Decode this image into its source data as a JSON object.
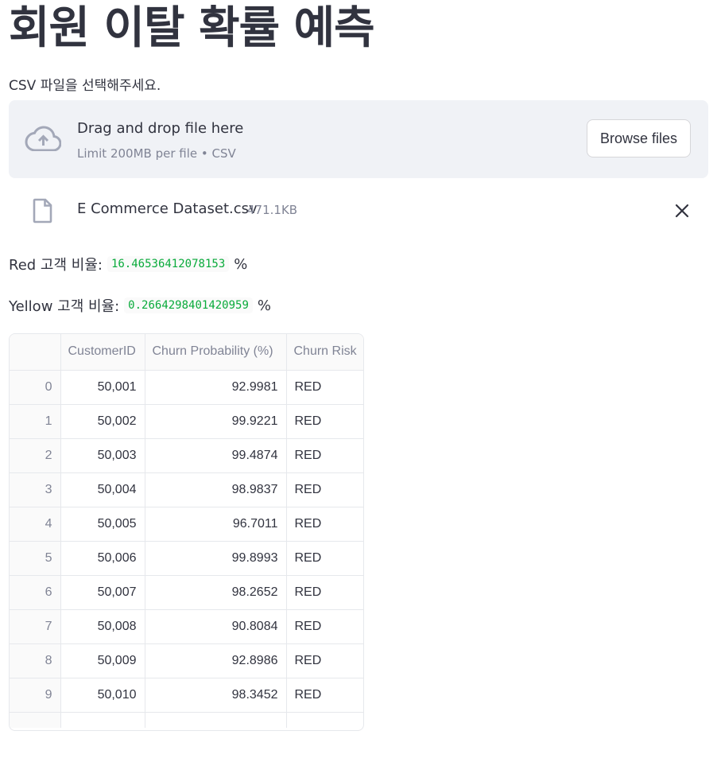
{
  "page": {
    "title": "회원 이탈 확률 예측"
  },
  "uploader": {
    "label": "CSV 파일을 선택해주세요.",
    "drop_text": "Drag and drop file here",
    "limit_text": "Limit 200MB per file • CSV",
    "browse_label": "Browse files",
    "upload_icon": "cloud-upload-icon"
  },
  "uploaded_file": {
    "name": "E Commerce Dataset.csv",
    "size": "471.1KB",
    "file_icon": "file-icon",
    "remove_icon": "close-icon"
  },
  "ratios": {
    "red_label": "Red 고객 비율:",
    "red_value": "16.46536412078153",
    "yellow_label": "Yellow 고객 비율:",
    "yellow_value": "0.2664298401420959",
    "unit": "%"
  },
  "table": {
    "columns": [
      "",
      "CustomerID",
      "Churn Probability (%)",
      "Churn Risk"
    ],
    "rows": [
      {
        "index": "0",
        "customer_id": "50,001",
        "prob": "92.9981",
        "risk": "RED"
      },
      {
        "index": "1",
        "customer_id": "50,002",
        "prob": "99.9221",
        "risk": "RED"
      },
      {
        "index": "2",
        "customer_id": "50,003",
        "prob": "99.4874",
        "risk": "RED"
      },
      {
        "index": "3",
        "customer_id": "50,004",
        "prob": "98.9837",
        "risk": "RED"
      },
      {
        "index": "4",
        "customer_id": "50,005",
        "prob": "96.7011",
        "risk": "RED"
      },
      {
        "index": "5",
        "customer_id": "50,006",
        "prob": "99.8993",
        "risk": "RED"
      },
      {
        "index": "6",
        "customer_id": "50,007",
        "prob": "98.2652",
        "risk": "RED"
      },
      {
        "index": "7",
        "customer_id": "50,008",
        "prob": "90.8084",
        "risk": "RED"
      },
      {
        "index": "8",
        "customer_id": "50,009",
        "prob": "92.8986",
        "risk": "RED"
      },
      {
        "index": "9",
        "customer_id": "50,010",
        "prob": "98.3452",
        "risk": "RED"
      }
    ]
  },
  "colors": {
    "text": "#31333f",
    "muted": "#808495",
    "code_green": "#09ab3b",
    "dropzone_bg": "#f0f2f6"
  }
}
